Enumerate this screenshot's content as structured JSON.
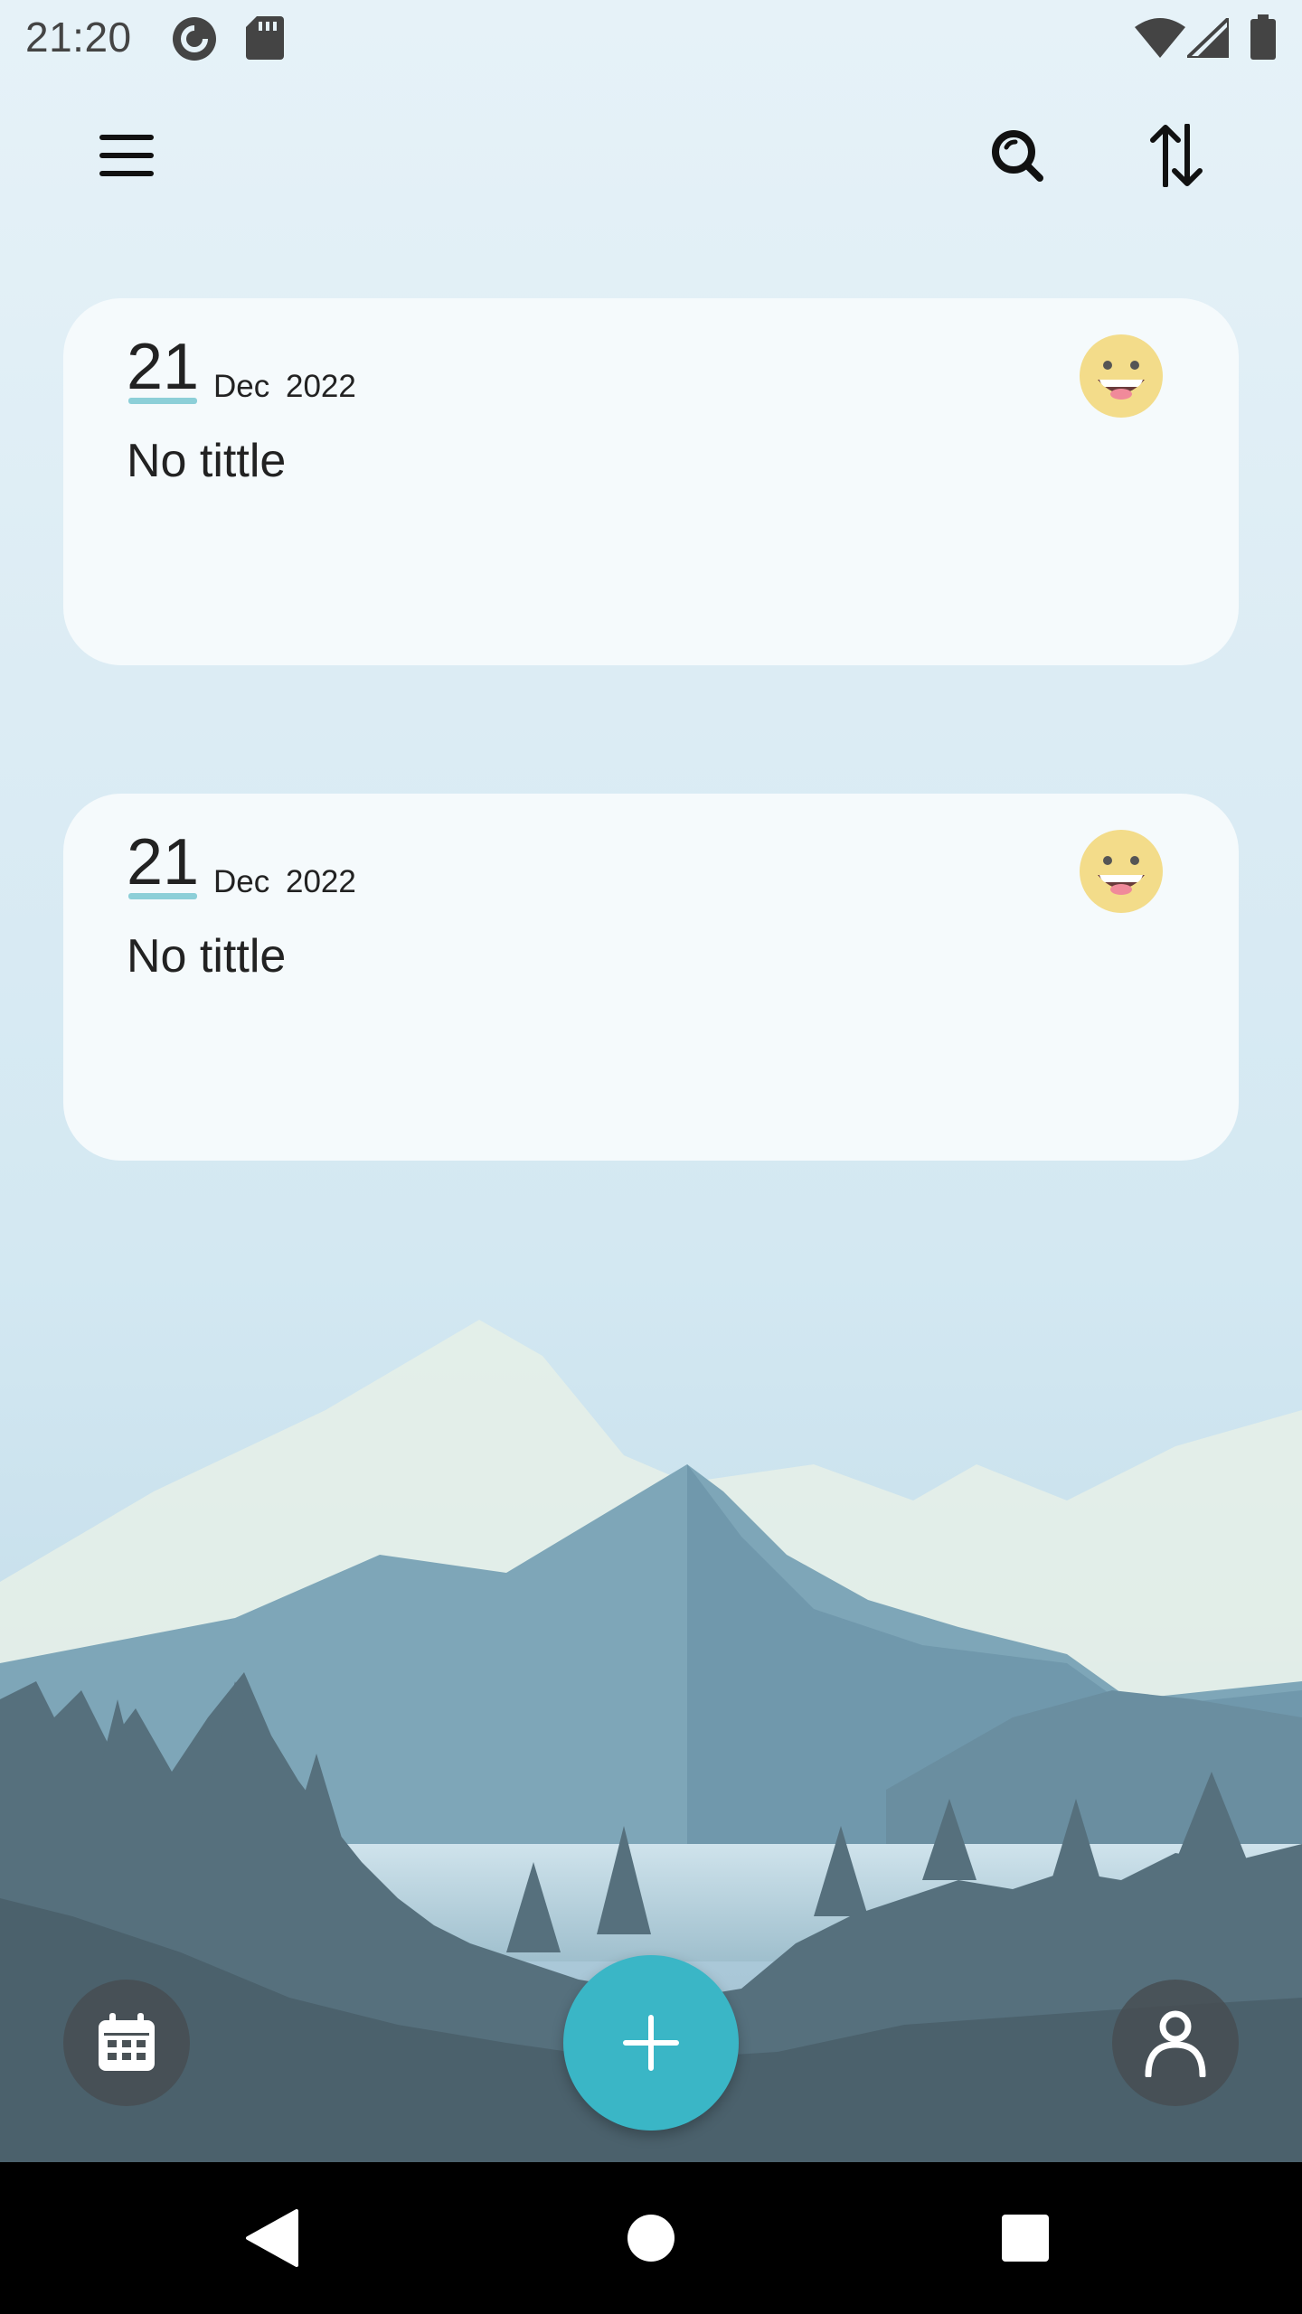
{
  "status_bar": {
    "time": "21:20",
    "icons": [
      "pocket-casts-icon",
      "sd-card-icon",
      "wifi-icon",
      "cell-signal-icon",
      "battery-icon"
    ]
  },
  "toolbar": {
    "icons": [
      "menu-icon",
      "search-icon",
      "sort-icon"
    ]
  },
  "entries": [
    {
      "day": "21",
      "month": "Dec",
      "year": "2022",
      "title": "No tittle",
      "mood": "grinning-face"
    },
    {
      "day": "21",
      "month": "Dec",
      "year": "2022",
      "title": "No tittle",
      "mood": "grinning-face"
    }
  ],
  "bottom_bar": {
    "icons": [
      "calendar-icon",
      "add-icon",
      "profile-icon"
    ]
  },
  "nav_bar": {
    "icons": [
      "back-icon",
      "home-icon",
      "recents-icon"
    ]
  },
  "colors": {
    "accent": "#3ab6c6",
    "card_bg": "#f6fafc",
    "day_underline": "#8ccfd8"
  }
}
